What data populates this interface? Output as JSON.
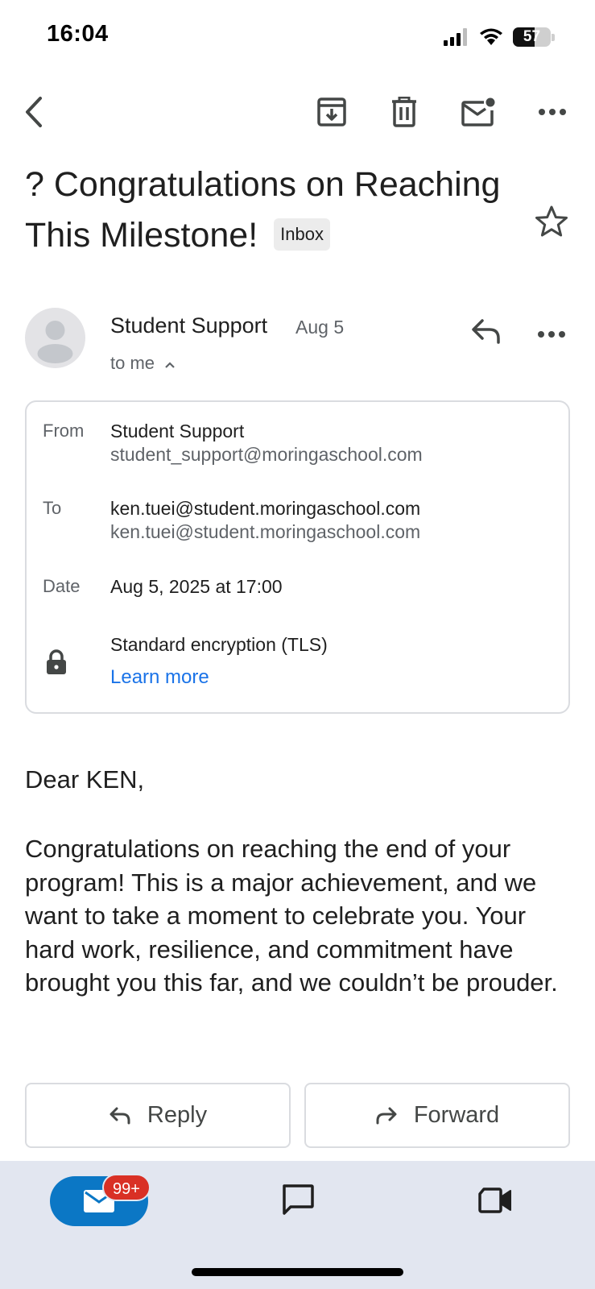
{
  "status_bar": {
    "time": "16:04",
    "battery": "57"
  },
  "subject": {
    "title": "? Congratulations on Reaching This Milestone!",
    "label": "Inbox"
  },
  "sender": {
    "name": "Student Support",
    "date": "Aug 5",
    "recipient_summary": "to me"
  },
  "details": {
    "from_label": "From",
    "from_name": "Student Support",
    "from_email": "student_support@moringaschool.com",
    "to_label": "To",
    "to_name": "ken.tuei@student.moringaschool.com",
    "to_email": "ken.tuei@student.moringaschool.com",
    "date_label": "Date",
    "date_value": "Aug 5, 2025 at 17:00",
    "encryption": "Standard encryption (TLS)",
    "learn_more": "Learn more"
  },
  "body": {
    "greeting": "Dear KEN,",
    "paragraph": "Congratulations on reaching the end of your program! This is a major achievement, and we want to take a moment to celebrate you. Your hard work, resilience, and commitment have brought you this far, and we couldn’t be prouder."
  },
  "actions": {
    "reply": "Reply",
    "forward": "Forward"
  },
  "bottom_nav": {
    "mail_badge": "99+"
  },
  "icons": [
    "back-icon",
    "archive-icon",
    "trash-icon",
    "mark-unread-icon",
    "more-icon",
    "star-icon",
    "reply-icon",
    "lock-icon",
    "mail-icon",
    "chat-icon",
    "video-icon"
  ],
  "colors": {
    "accent": "#1a73e8",
    "badge": "#d93025",
    "mail_pill": "#0b77c5",
    "nav_bg": "#e2e6f0"
  }
}
